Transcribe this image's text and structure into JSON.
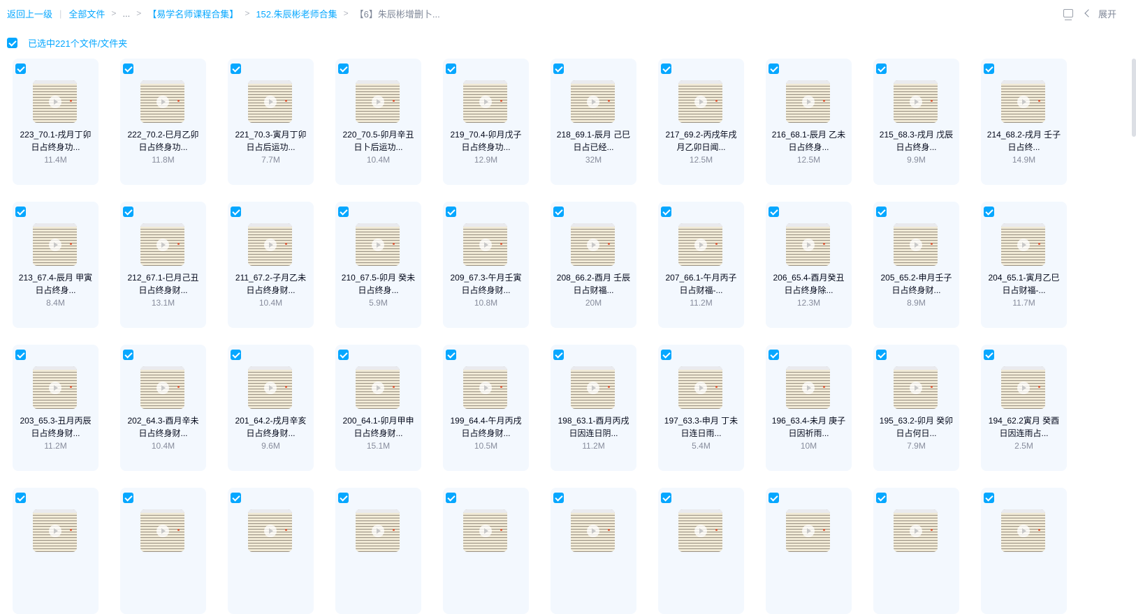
{
  "breadcrumb": {
    "back": "返回上一级",
    "all_files": "全部文件",
    "ellipsis": "...",
    "level1": "【易学名师课程合集】",
    "level2": "152.朱辰彬老师合集",
    "current": "【6】朱辰彬增删卜..."
  },
  "top_right": {
    "expand_label": "展开",
    "view_icon": "view-toggle-icon"
  },
  "selection": {
    "text": "已选中221个文件/文件夹"
  },
  "accent_color": "#06a7ff",
  "files": [
    {
      "name": "223_70.1-戌月丁卯日占终身功...",
      "size": "11.4M"
    },
    {
      "name": "222_70.2-巳月乙卯日占终身功...",
      "size": "11.8M"
    },
    {
      "name": "221_70.3-寅月丁卯日占后运功...",
      "size": "7.7M"
    },
    {
      "name": "220_70.5-卯月辛丑日卜后运功...",
      "size": "10.4M"
    },
    {
      "name": "219_70.4-卯月戊子日占终身功...",
      "size": "12.9M"
    },
    {
      "name": "218_69.1-辰月 己巳日占已经...",
      "size": "32M"
    },
    {
      "name": "217_69.2-丙戌年戌月乙卯日闻...",
      "size": "12.5M"
    },
    {
      "name": "216_68.1-辰月 乙未日占终身...",
      "size": "12.5M"
    },
    {
      "name": "215_68.3-戌月 戊辰日占终身...",
      "size": "9.9M"
    },
    {
      "name": "214_68.2-戌月 壬子日占终...",
      "size": "14.9M"
    },
    {
      "name": "213_67.4-辰月 甲寅日占终身...",
      "size": "8.4M"
    },
    {
      "name": "212_67.1-巳月己丑日占终身财...",
      "size": "13.1M"
    },
    {
      "name": "211_67.2-子月乙未日占终身财...",
      "size": "10.4M"
    },
    {
      "name": "210_67.5-卯月 癸未日占终身...",
      "size": "5.9M"
    },
    {
      "name": "209_67.3-午月壬寅日占终身财...",
      "size": "10.8M"
    },
    {
      "name": "208_66.2-酉月 壬辰日占财福...",
      "size": "20M"
    },
    {
      "name": "207_66.1-午月丙子日占财福-...",
      "size": "11.2M"
    },
    {
      "name": "206_65.4-酉月癸丑日占终身除...",
      "size": "12.3M"
    },
    {
      "name": "205_65.2-申月壬子日占终身财...",
      "size": "8.9M"
    },
    {
      "name": "204_65.1-寅月乙巳日占财福-...",
      "size": "11.7M"
    },
    {
      "name": "203_65.3-丑月丙辰日占终身财...",
      "size": "11.2M"
    },
    {
      "name": "202_64.3-酉月辛未日占终身财...",
      "size": "10.4M"
    },
    {
      "name": "201_64.2-戌月辛亥日占终身财...",
      "size": "9.6M"
    },
    {
      "name": "200_64.1-卯月甲申日占终身财...",
      "size": "15.1M"
    },
    {
      "name": "199_64.4-午月丙戌日占终身财...",
      "size": "10.5M"
    },
    {
      "name": "198_63.1-酉月丙戌日因连日阴...",
      "size": "11.2M"
    },
    {
      "name": "197_63.3-申月 丁未日连日雨...",
      "size": "5.4M"
    },
    {
      "name": "196_63.4-未月 庚子日因祈雨...",
      "size": "10M"
    },
    {
      "name": "195_63.2-卯月 癸卯日占何日...",
      "size": "7.9M"
    },
    {
      "name": "194_62.2寅月 癸酉日因连雨占...",
      "size": "2.5M"
    },
    {
      "name": "",
      "size": ""
    },
    {
      "name": "",
      "size": ""
    },
    {
      "name": "",
      "size": ""
    },
    {
      "name": "",
      "size": ""
    },
    {
      "name": "",
      "size": ""
    },
    {
      "name": "",
      "size": ""
    },
    {
      "name": "",
      "size": ""
    },
    {
      "name": "",
      "size": ""
    },
    {
      "name": "",
      "size": ""
    },
    {
      "name": "",
      "size": ""
    }
  ]
}
